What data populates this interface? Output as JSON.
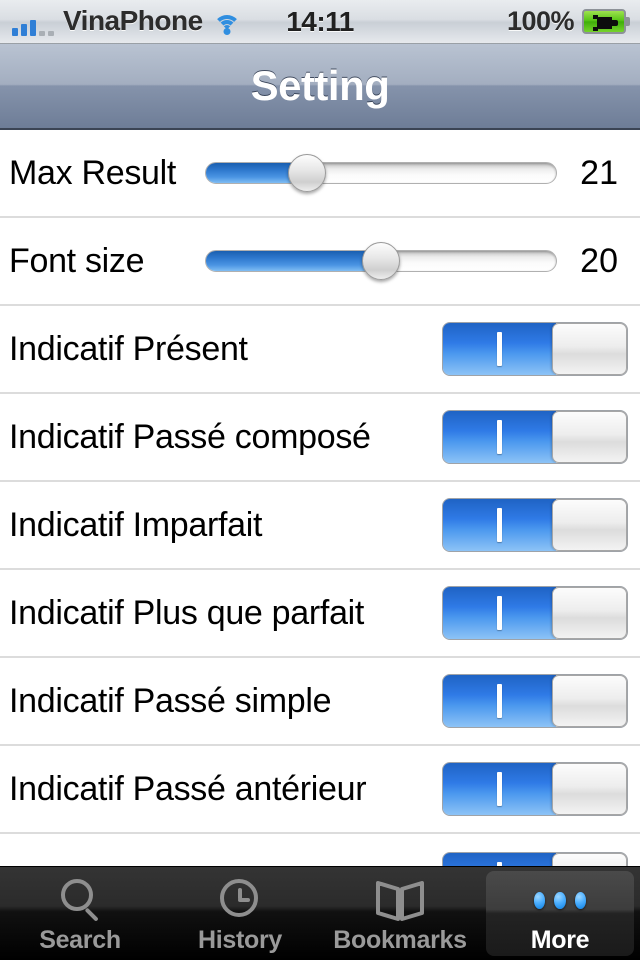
{
  "statusbar": {
    "carrier": "VinaPhone",
    "time": "14:11",
    "battery_percent": "100%",
    "signal_icon": "signal-bars-icon",
    "wifi_icon": "wifi-icon",
    "battery_icon": "battery-charging-icon",
    "signal_bars_filled": 3,
    "signal_bars_total": 5
  },
  "navbar": {
    "title": "Setting"
  },
  "settings": {
    "sliders": [
      {
        "label": "Max Result",
        "value": "21",
        "fill_percent": 29
      },
      {
        "label": "Font size",
        "value": "20",
        "fill_percent": 50
      }
    ],
    "switches": [
      {
        "label": "Indicatif Présent",
        "state": "on"
      },
      {
        "label": "Indicatif Passé composé",
        "state": "on"
      },
      {
        "label": "Indicatif Imparfait",
        "state": "on"
      },
      {
        "label": "Indicatif Plus que parfait",
        "state": "on"
      },
      {
        "label": "Indicatif Passé simple",
        "state": "on"
      },
      {
        "label": "Indicatif Passé antérieur",
        "state": "on"
      }
    ],
    "partial_row": {
      "label": "",
      "state": "on"
    }
  },
  "tabbar": {
    "tabs": [
      {
        "label": "Search",
        "icon": "magnifier-icon",
        "selected": false
      },
      {
        "label": "History",
        "icon": "clock-icon",
        "selected": false
      },
      {
        "label": "Bookmarks",
        "icon": "book-icon",
        "selected": false
      },
      {
        "label": "More",
        "icon": "three-dots-icon",
        "selected": true
      }
    ]
  },
  "colors": {
    "accent_blue": "#2f7ae6",
    "navbar_top": "#b9c3d2",
    "navbar_bottom": "#6e7d97",
    "separator": "#dcdcdc",
    "tabbar_bg": "#000000",
    "tab_label": "#9a9a9a",
    "battery_green": "#58c516"
  }
}
